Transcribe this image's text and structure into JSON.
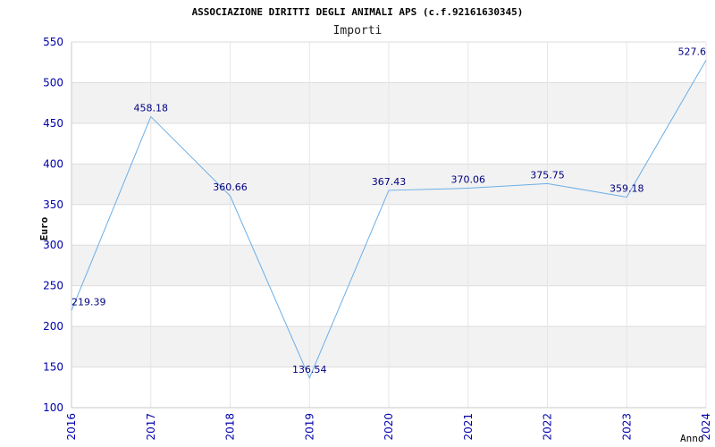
{
  "chart_data": {
    "type": "line",
    "title": "ASSOCIAZIONE DIRITTI DEGLI ANIMALI APS (c.f.92161630345)",
    "subtitle": "Importi",
    "xlabel": "Anno",
    "ylabel": "Euro",
    "x": [
      "2016",
      "2017",
      "2018",
      "2019",
      "2020",
      "2021",
      "2022",
      "2023",
      "2024"
    ],
    "series": [
      {
        "values": [
          219.39,
          458.18,
          360.66,
          136.54,
          367.43,
          370.06,
          375.75,
          359.18,
          527.6
        ],
        "labels": [
          "219.39",
          "458.18",
          "360.66",
          "136.54",
          "367.43",
          "370.06",
          "375.75",
          "359.18",
          "527.6"
        ]
      }
    ],
    "ylim": [
      100,
      550
    ],
    "yticks": [
      100,
      150,
      200,
      250,
      300,
      350,
      400,
      450,
      500,
      550
    ],
    "grid": true,
    "band_colors": [
      "#ffffff",
      "#f2f2f2"
    ],
    "line_color": "#6aaee6",
    "tick_color": "#0000aa",
    "label_color": "#000080"
  }
}
